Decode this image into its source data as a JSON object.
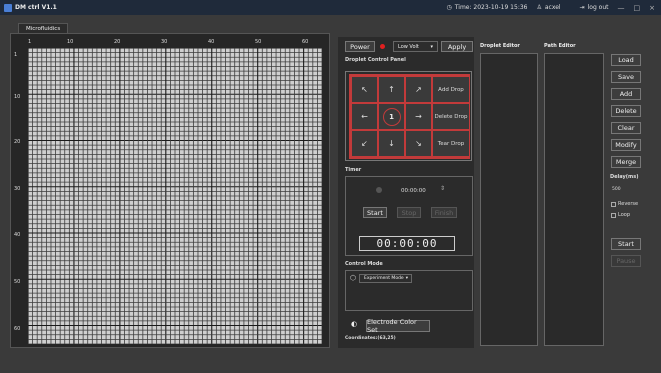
{
  "window": {
    "title": "DM ctrl V1.1",
    "time": "Time: 2023-10-19 15:36",
    "user": "acxel",
    "logout": "log out",
    "minimize": "—",
    "maximize": "□",
    "close": "×"
  },
  "tabs": [
    "Microfluidics"
  ],
  "grid": {
    "col_labels": [
      "1",
      "10",
      "20",
      "30",
      "40",
      "50",
      "60"
    ],
    "row_labels": [
      "1",
      "10",
      "20",
      "30",
      "40",
      "50",
      "60"
    ]
  },
  "toolbar": {
    "power": "Power",
    "volt_select": "Low Volt",
    "apply": "Apply",
    "status_color": "#e02020"
  },
  "droplet_panel": {
    "title": "Droplet Control Panel",
    "up_left": "↖",
    "up": "↑",
    "up_right": "↗",
    "left": "←",
    "center": "1",
    "right": "→",
    "down_left": "↙",
    "down": "↓",
    "down_right": "↘",
    "add_drop": "Add Drop",
    "delete_drop": "Delete Drop",
    "tear_drop": "Tear Drop"
  },
  "timer": {
    "title": "Timer",
    "value": "00:00:00",
    "start": "Start",
    "stop": "Stop",
    "finish": "Finish",
    "display": "00:00:00"
  },
  "control_mode": {
    "title": "Control Mode",
    "value": "Experiment Mode"
  },
  "electrode": {
    "button": "Electrode Color Set",
    "coordinates": "Coordinates:(63,25)"
  },
  "editors": {
    "droplet": "Droplet Editor",
    "path": "Path Editor"
  },
  "side_buttons": {
    "load": "Load",
    "save": "Save",
    "add": "Add",
    "delete": "Delete",
    "clear": "Clear",
    "modify": "Modify",
    "merge": "Merge"
  },
  "delay": {
    "label": "Delay(ms)",
    "value": "500",
    "reverse": "Reverse",
    "loop": "Loop"
  },
  "run": {
    "start": "Start",
    "pause": "Pause"
  }
}
